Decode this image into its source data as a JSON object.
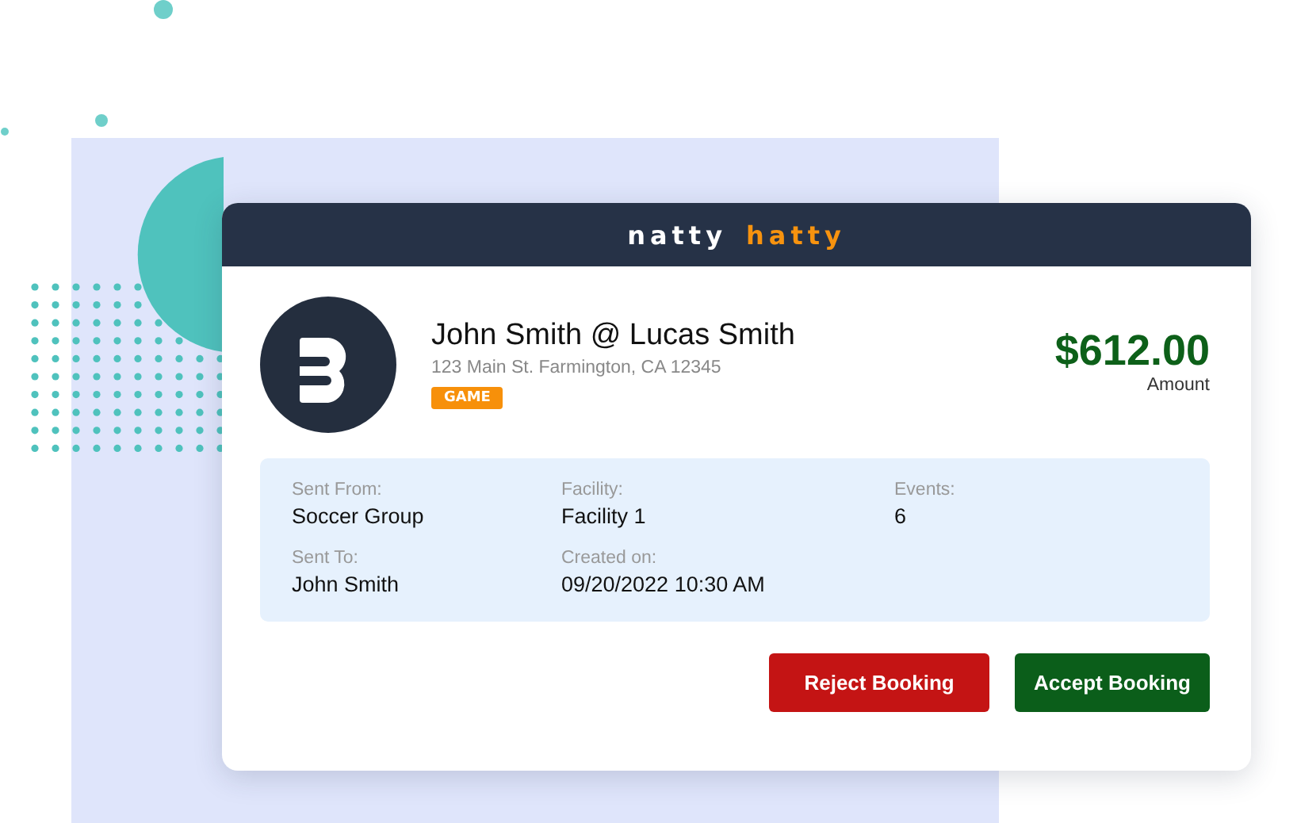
{
  "logo": [
    {
      "text": "natty",
      "color": "#ffffff"
    },
    {
      "text": "hatty",
      "color": "#f7930f"
    }
  ],
  "booking": {
    "title": "John Smith @ Lucas Smith",
    "address": "123 Main St. Farmington, CA 12345",
    "tag": "GAME",
    "amount": "$612.00",
    "amount_label": "Amount"
  },
  "details": [
    {
      "label": "Sent From:",
      "value": "Soccer Group"
    },
    {
      "label": "Facility:",
      "value": "Facility 1"
    },
    {
      "label": "Events:",
      "value": "6"
    },
    {
      "label": "Sent To:",
      "value": "John Smith"
    },
    {
      "label": "Created on:",
      "value": "09/20/2022 10:30 AM"
    }
  ],
  "buttons": [
    {
      "label": "Reject Booking",
      "kind": "reject"
    },
    {
      "label": "Accept Booking",
      "kind": "accept"
    }
  ]
}
